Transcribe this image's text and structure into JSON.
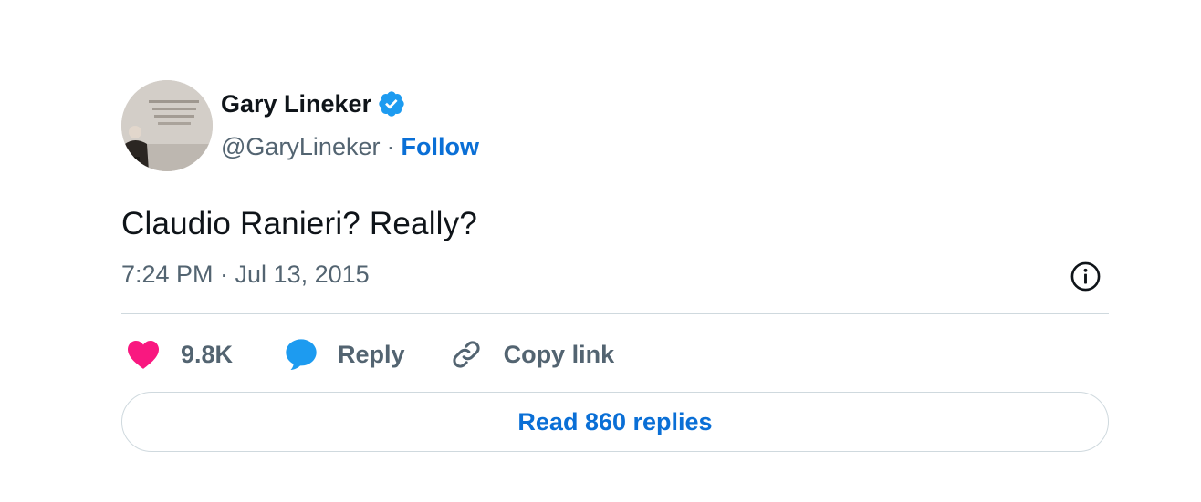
{
  "author": {
    "name": "Gary Lineker",
    "handle": "@GaryLineker",
    "separator": "·",
    "follow_label": "Follow",
    "verified": true
  },
  "tweet": {
    "text": "Claudio Ranieri? Really?",
    "timestamp": "7:24 PM · Jul 13, 2015"
  },
  "actions": {
    "like_count": "9.8K",
    "reply_label": "Reply",
    "copy_link_label": "Copy link"
  },
  "read_replies_label": "Read 860 replies",
  "colors": {
    "link_blue": "#0a6fd6",
    "verified_blue": "#1d9bf0",
    "like_pink": "#f91880",
    "muted_text": "#536471",
    "divider": "#cfd9de"
  },
  "icons": [
    "verified-badge-icon",
    "info-icon",
    "heart-icon",
    "reply-bubble-icon",
    "link-icon"
  ]
}
